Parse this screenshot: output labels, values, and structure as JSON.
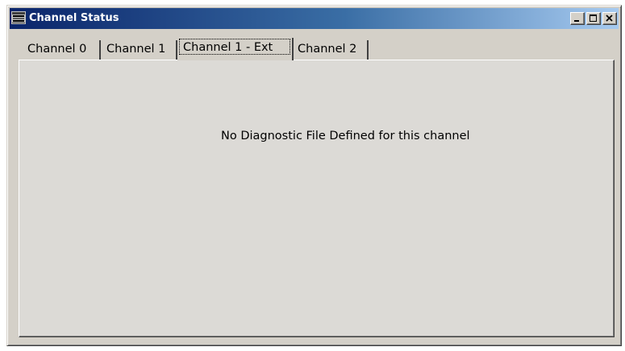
{
  "window": {
    "title": "Channel Status",
    "icon": "channel-status-app-icon",
    "buttons": [
      "minimize-icon",
      "maximize-icon",
      "close-icon"
    ]
  },
  "tabs": [
    {
      "label": "Channel 0",
      "selected": false
    },
    {
      "label": "Channel 1",
      "selected": false
    },
    {
      "label": "Channel 1 - Ext",
      "selected": true
    },
    {
      "label": "Channel 2",
      "selected": false
    }
  ],
  "panel": {
    "message": "No Diagnostic File Defined for this channel"
  },
  "colors": {
    "titlebar_start": "#0a246a",
    "titlebar_end": "#a6caf0",
    "face": "#d4d0c8"
  }
}
